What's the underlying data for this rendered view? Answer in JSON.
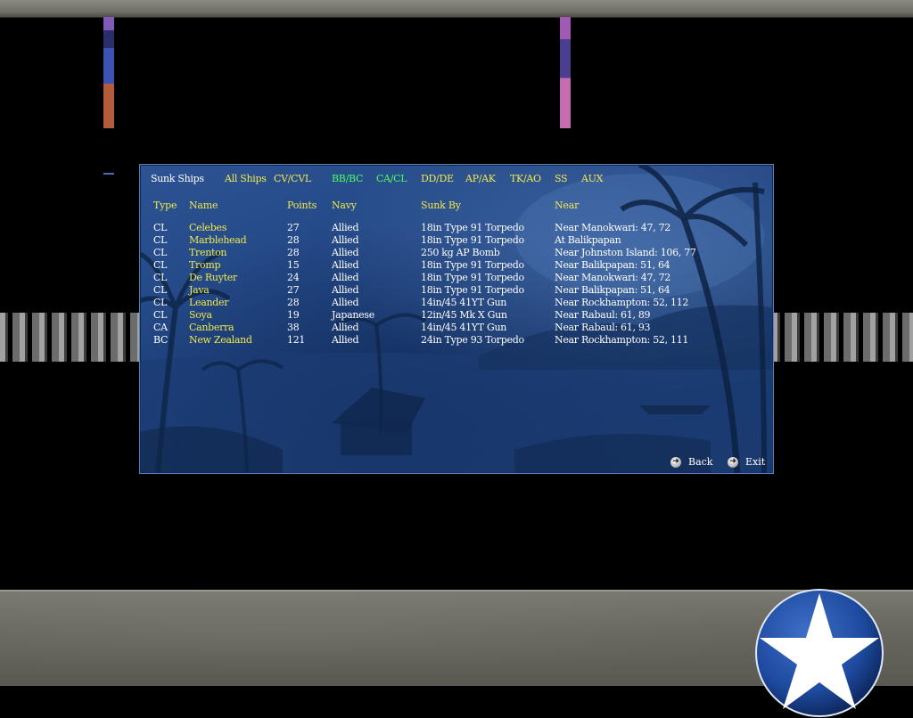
{
  "screen": {
    "title": "Sunk Ships",
    "tabs": [
      {
        "label": "All Ships",
        "active": false
      },
      {
        "label": "CV/CVL",
        "active": false
      },
      {
        "label": "BB/BC",
        "active": true
      },
      {
        "label": "CA/CL",
        "active": true
      },
      {
        "label": "DD/DE",
        "active": false
      },
      {
        "label": "AP/AK",
        "active": false
      },
      {
        "label": "TK/AO",
        "active": false
      },
      {
        "label": "SS",
        "active": false
      },
      {
        "label": "AUX",
        "active": false
      }
    ],
    "columns": {
      "type": "Type",
      "name": "Name",
      "points": "Points",
      "navy": "Navy",
      "sunk_by": "Sunk By",
      "near": "Near"
    },
    "rows": [
      {
        "type": "CL",
        "name": "Celebes",
        "points": "27",
        "navy": "Allied",
        "sunk_by": "18in Type 91 Torpedo",
        "near": "Near Manokwari: 47, 72"
      },
      {
        "type": "CL",
        "name": "Marblehead",
        "points": "28",
        "navy": "Allied",
        "sunk_by": "18in Type 91 Torpedo",
        "near": "At Balikpapan"
      },
      {
        "type": "CL",
        "name": "Trenton",
        "points": "28",
        "navy": "Allied",
        "sunk_by": "250 kg AP Bomb",
        "near": "Near Johnston Island: 106, 77"
      },
      {
        "type": "CL",
        "name": "Tromp",
        "points": "15",
        "navy": "Allied",
        "sunk_by": "18in Type 91 Torpedo",
        "near": "Near Balikpapan: 51, 64"
      },
      {
        "type": "CL",
        "name": "De Ruyter",
        "points": "24",
        "navy": "Allied",
        "sunk_by": "18in Type 91 Torpedo",
        "near": "Near Manokwari: 47, 72"
      },
      {
        "type": "CL",
        "name": "Java",
        "points": "27",
        "navy": "Allied",
        "sunk_by": "18in Type 91 Torpedo",
        "near": "Near Balikpapan: 51, 64"
      },
      {
        "type": "CL",
        "name": "Leander",
        "points": "28",
        "navy": "Allied",
        "sunk_by": "14in/45 41YT Gun",
        "near": "Near Rockhampton: 52, 112"
      },
      {
        "type": "CL",
        "name": "Soya",
        "points": "19",
        "navy": "Japanese",
        "sunk_by": "12in/45 Mk X Gun",
        "near": "Near Rabaul: 61, 89"
      },
      {
        "type": "CA",
        "name": "Canberra",
        "points": "38",
        "navy": "Allied",
        "sunk_by": "14in/45 41YT Gun",
        "near": "Near Rabaul: 61, 93"
      },
      {
        "type": "BC",
        "name": "New Zealand",
        "points": "121",
        "navy": "Allied",
        "sunk_by": "24in Type 93 Torpedo",
        "near": "Near Rockhampton: 52, 111"
      }
    ],
    "buttons": {
      "back": "Back",
      "exit": "Exit"
    }
  },
  "colors": {
    "tab_yellow": "#f0e84a",
    "tab_active_green": "#4aff5a",
    "panel_blue": "#1f437f",
    "insignia_blue": "#1d4a9e"
  },
  "icons": {
    "nav_arrow": "arrow-right-circle-icon",
    "insignia": "white-star-roundel-icon"
  }
}
